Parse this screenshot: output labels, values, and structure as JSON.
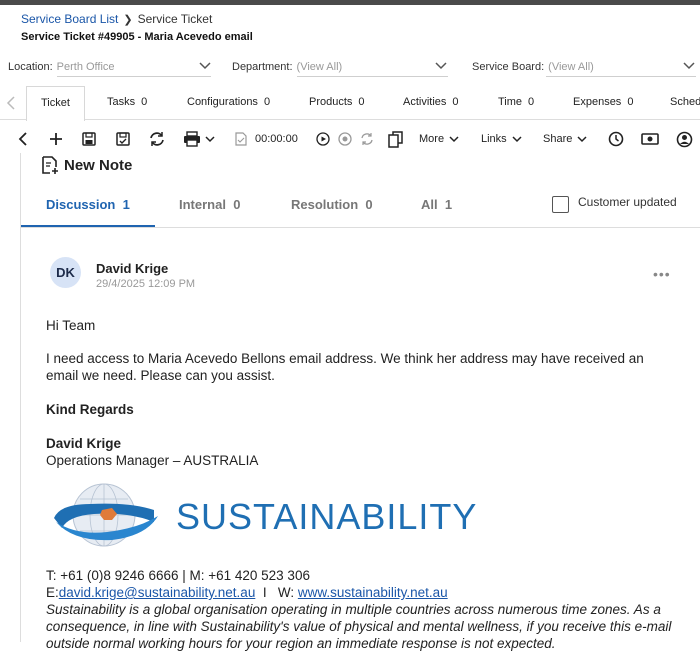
{
  "breadcrumb": {
    "parent": "Service Board List",
    "current": "Service Ticket"
  },
  "ticket_title": "Service Ticket #49905 - Maria Acevedo email",
  "filters": {
    "location": {
      "label": "Location:",
      "value": "Perth Office"
    },
    "department": {
      "label": "Department:",
      "value": "(View All)"
    },
    "service_board": {
      "label": "Service Board:",
      "value": "(View All)"
    }
  },
  "tabs": [
    {
      "label": "Ticket",
      "count": ""
    },
    {
      "label": "Tasks",
      "count": "0"
    },
    {
      "label": "Configurations",
      "count": "0"
    },
    {
      "label": "Products",
      "count": "0"
    },
    {
      "label": "Activities",
      "count": "0"
    },
    {
      "label": "Time",
      "count": "0"
    },
    {
      "label": "Expenses",
      "count": "0"
    },
    {
      "label": "Sched",
      "count": ""
    }
  ],
  "toolbar": {
    "timer": "00:00:00",
    "more": "More",
    "links": "Links",
    "share": "Share"
  },
  "note": {
    "new_note": "New Note",
    "tabs": [
      {
        "label": "Discussion",
        "count": "1"
      },
      {
        "label": "Internal",
        "count": "0"
      },
      {
        "label": "Resolution",
        "count": "0"
      },
      {
        "label": "All",
        "count": "1"
      }
    ],
    "customer_updated": "Customer updated"
  },
  "message": {
    "initials": "DK",
    "author": "David Krige",
    "date": "29/4/2025 12:09 PM",
    "greeting": "Hi Team",
    "body_line1": "I need access to Maria Acevedo Bellons email address. We think her address may have received an",
    "body_line2": "email we need. Please can you assist.",
    "regards": "Kind Regards",
    "sig_name": "David Krige",
    "sig_title": "Operations Manager – AUSTRALIA",
    "logo_text": "SUSTAINABILITY",
    "phone_line": "T: +61 (0)8 9246 6666  |  M: +61 420 523 306",
    "email_prefix": "E:",
    "email": "david.krige@sustainability.net.au",
    "web_sep": "  I   W: ",
    "website": "www.sustainability.net.au",
    "disclaimer1": "Sustainability is a global organisation operating in multiple countries across numerous time zones. As a",
    "disclaimer2": "consequence, in line with Sustainability's value of physical and mental wellness, if you receive this e-mail",
    "disclaimer3": "outside normal working hours for your region an immediate response is not expected."
  },
  "colors": {
    "accent": "#1f64b0",
    "link": "#1a56a8",
    "logo_blue": "#1f6fb3"
  }
}
